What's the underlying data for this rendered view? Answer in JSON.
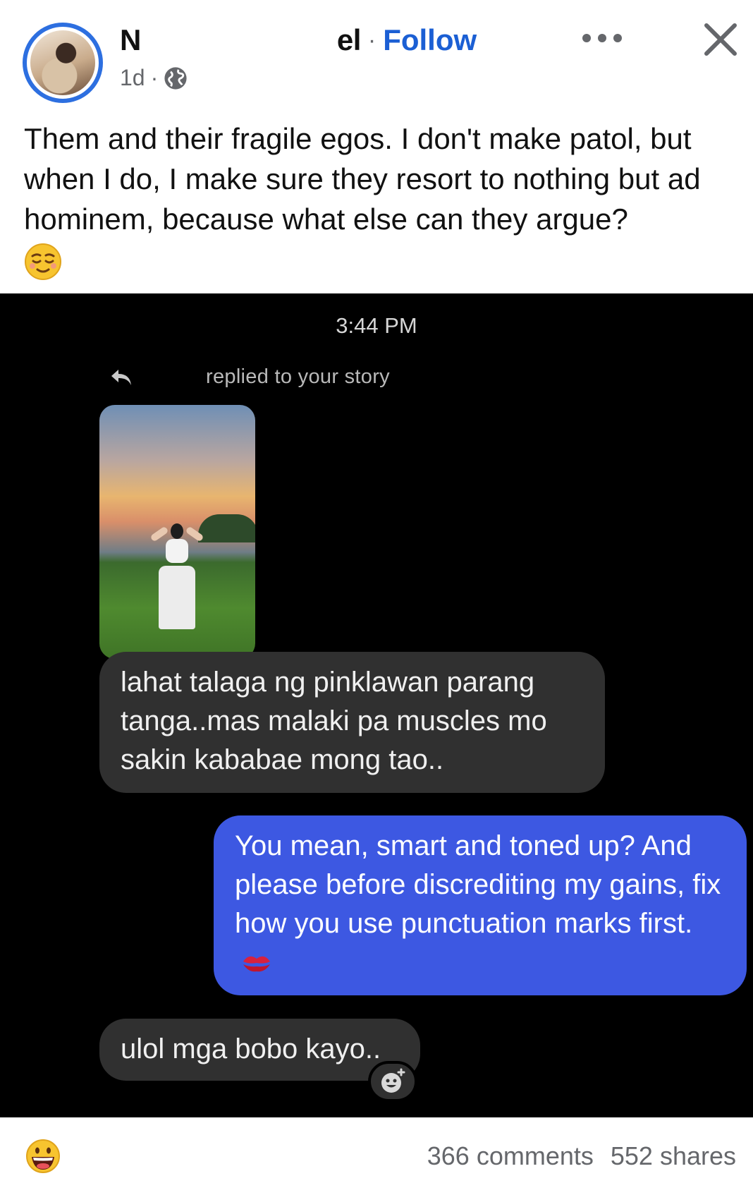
{
  "post": {
    "author_initial": "N",
    "author_suffix": "el",
    "separator": "·",
    "follow_label": "Follow",
    "time": "1d",
    "time_separator": "·",
    "caption": "Them and their fragile egos. I don't make patol, but when I do, I make sure they resort to nothing but ad hominem, because what else can they argue?",
    "caption_emoji": "relieved-face-icon"
  },
  "chat": {
    "time": "3:44 PM",
    "story_note": "replied to your story",
    "messages": [
      {
        "direction": "incoming",
        "text": "lahat talaga ng pinklawan parang tanga..mas malaki pa muscles mo sakin kababae mong tao.."
      },
      {
        "direction": "outgoing",
        "text": "You mean, smart and toned up? And please before discrediting my gains, fix how you use punctuation marks first."
      },
      {
        "direction": "incoming",
        "text": "ulol mga bobo kayo.."
      }
    ],
    "colors": {
      "incoming": "#303030",
      "outgoing": "#3d58e2",
      "background": "#000000"
    }
  },
  "footer": {
    "reaction_emoji": "grinning-face-icon",
    "comments": "366 comments",
    "shares": "552 shares"
  },
  "colors": {
    "accent": "#1b5fd4",
    "avatar_ring": "#2d6fe0",
    "muted": "#65676b"
  }
}
